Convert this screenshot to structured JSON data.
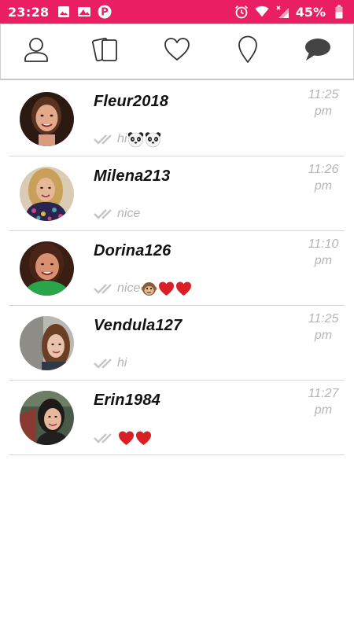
{
  "status_bar": {
    "time": "23:28",
    "battery": "45%",
    "left_icons": [
      "image-icon",
      "photos-icon",
      "p-app-icon"
    ],
    "right_icons": [
      "alarm-icon",
      "wifi-icon",
      "signal-icon",
      "battery-icon"
    ],
    "background": "#e91e63"
  },
  "tabs": [
    {
      "name": "profile",
      "icon": "user-icon"
    },
    {
      "name": "cards",
      "icon": "cards-icon"
    },
    {
      "name": "likes",
      "icon": "heart-icon"
    },
    {
      "name": "location",
      "icon": "location-pin-icon"
    },
    {
      "name": "messages",
      "icon": "chat-bubble-icon",
      "active": true
    }
  ],
  "chats": [
    {
      "name": "Fleur2018",
      "time_line1": "11:25",
      "time_line2": "pm",
      "preview": "hi",
      "emojis": [
        "panda-icon",
        "panda-icon"
      ]
    },
    {
      "name": "Milena213",
      "time_line1": "11:26",
      "time_line2": "pm",
      "preview": "nice",
      "emojis": []
    },
    {
      "name": "Dorina126",
      "time_line1": "11:10",
      "time_line2": "pm",
      "preview": "nice",
      "emojis": [
        "monkey-icon",
        "heart-emoji-icon",
        "heart-emoji-icon"
      ]
    },
    {
      "name": "Vendula127",
      "time_line1": "11:25",
      "time_line2": "pm",
      "preview": "hi",
      "emojis": []
    },
    {
      "name": "Erin1984",
      "time_line1": "11:27",
      "time_line2": "pm",
      "preview": "",
      "emojis": [
        "heart-emoji-icon",
        "heart-emoji-icon"
      ]
    }
  ],
  "colors": {
    "accent": "#e91e63",
    "muted_text": "#b5b5b5",
    "divider": "#d6d6d6",
    "heart_emoji": "#d91e26"
  }
}
